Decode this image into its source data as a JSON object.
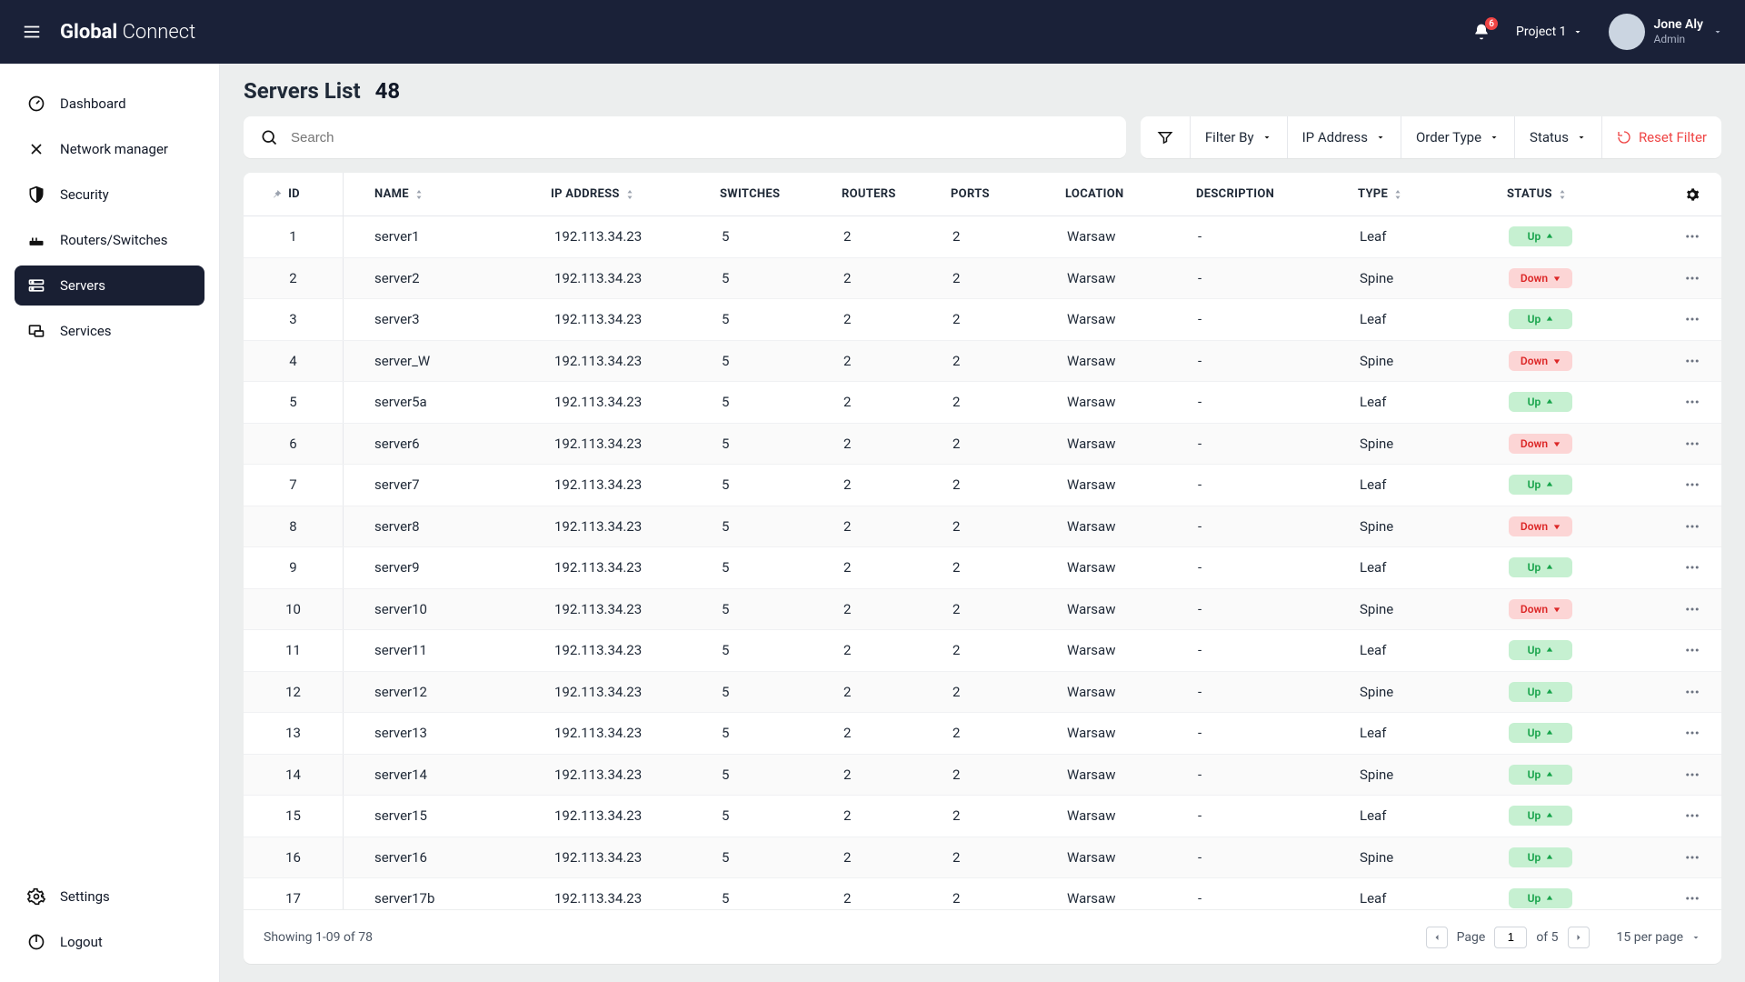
{
  "brand": {
    "bold": "Global",
    "light": "Connect"
  },
  "header": {
    "notification_count": "6",
    "project_label": "Project 1",
    "user_name": "Jone Aly",
    "user_role": "Admin"
  },
  "sidebar": {
    "items": [
      {
        "label": "Dashboard"
      },
      {
        "label": "Network manager"
      },
      {
        "label": "Security"
      },
      {
        "label": "Routers/Switches"
      },
      {
        "label": "Servers"
      },
      {
        "label": "Services"
      }
    ],
    "settings_label": "Settings",
    "logout_label": "Logout"
  },
  "page": {
    "title": "Servers List",
    "count": "48",
    "search_placeholder": "Search"
  },
  "filters": {
    "filter_by": "Filter By",
    "ip_address": "IP Address",
    "order_type": "Order Type",
    "status": "Status",
    "reset": "Reset Filter"
  },
  "columns": {
    "id": "ID",
    "name": "NAME",
    "ip": "IP ADDRESS",
    "switches": "SWITCHES",
    "routers": "ROUTERS",
    "ports": "PORTS",
    "location": "LOCATION",
    "description": "DESCRIPTION",
    "type": "TYPE",
    "status": "STATUS"
  },
  "rows": [
    {
      "id": "1",
      "name": "server1",
      "ip": "192.113.34.23",
      "switches": "5",
      "routers": "2",
      "ports": "2",
      "location": "Warsaw",
      "description": "-",
      "type": "Leaf",
      "status": "Up"
    },
    {
      "id": "2",
      "name": "server2",
      "ip": "192.113.34.23",
      "switches": "5",
      "routers": "2",
      "ports": "2",
      "location": "Warsaw",
      "description": "-",
      "type": "Spine",
      "status": "Down"
    },
    {
      "id": "3",
      "name": "server3",
      "ip": "192.113.34.23",
      "switches": "5",
      "routers": "2",
      "ports": "2",
      "location": "Warsaw",
      "description": "-",
      "type": "Leaf",
      "status": "Up"
    },
    {
      "id": "4",
      "name": "server_W",
      "ip": "192.113.34.23",
      "switches": "5",
      "routers": "2",
      "ports": "2",
      "location": "Warsaw",
      "description": "-",
      "type": "Spine",
      "status": "Down"
    },
    {
      "id": "5",
      "name": "server5a",
      "ip": "192.113.34.23",
      "switches": "5",
      "routers": "2",
      "ports": "2",
      "location": "Warsaw",
      "description": "-",
      "type": "Leaf",
      "status": "Up"
    },
    {
      "id": "6",
      "name": "server6",
      "ip": "192.113.34.23",
      "switches": "5",
      "routers": "2",
      "ports": "2",
      "location": "Warsaw",
      "description": "-",
      "type": "Spine",
      "status": "Down"
    },
    {
      "id": "7",
      "name": "server7",
      "ip": "192.113.34.23",
      "switches": "5",
      "routers": "2",
      "ports": "2",
      "location": "Warsaw",
      "description": "-",
      "type": "Leaf",
      "status": "Up"
    },
    {
      "id": "8",
      "name": "server8",
      "ip": "192.113.34.23",
      "switches": "5",
      "routers": "2",
      "ports": "2",
      "location": "Warsaw",
      "description": "-",
      "type": "Spine",
      "status": "Down"
    },
    {
      "id": "9",
      "name": "server9",
      "ip": "192.113.34.23",
      "switches": "5",
      "routers": "2",
      "ports": "2",
      "location": "Warsaw",
      "description": "-",
      "type": "Leaf",
      "status": "Up"
    },
    {
      "id": "10",
      "name": "server10",
      "ip": "192.113.34.23",
      "switches": "5",
      "routers": "2",
      "ports": "2",
      "location": "Warsaw",
      "description": "-",
      "type": "Spine",
      "status": "Down"
    },
    {
      "id": "11",
      "name": "server11",
      "ip": "192.113.34.23",
      "switches": "5",
      "routers": "2",
      "ports": "2",
      "location": "Warsaw",
      "description": "-",
      "type": "Leaf",
      "status": "Up"
    },
    {
      "id": "12",
      "name": "server12",
      "ip": "192.113.34.23",
      "switches": "5",
      "routers": "2",
      "ports": "2",
      "location": "Warsaw",
      "description": "-",
      "type": "Spine",
      "status": "Up"
    },
    {
      "id": "13",
      "name": "server13",
      "ip": "192.113.34.23",
      "switches": "5",
      "routers": "2",
      "ports": "2",
      "location": "Warsaw",
      "description": "-",
      "type": "Leaf",
      "status": "Up"
    },
    {
      "id": "14",
      "name": "server14",
      "ip": "192.113.34.23",
      "switches": "5",
      "routers": "2",
      "ports": "2",
      "location": "Warsaw",
      "description": "-",
      "type": "Spine",
      "status": "Up"
    },
    {
      "id": "15",
      "name": "server15",
      "ip": "192.113.34.23",
      "switches": "5",
      "routers": "2",
      "ports": "2",
      "location": "Warsaw",
      "description": "-",
      "type": "Leaf",
      "status": "Up"
    },
    {
      "id": "16",
      "name": "server16",
      "ip": "192.113.34.23",
      "switches": "5",
      "routers": "2",
      "ports": "2",
      "location": "Warsaw",
      "description": "-",
      "type": "Spine",
      "status": "Up"
    },
    {
      "id": "17",
      "name": "server17b",
      "ip": "192.113.34.23",
      "switches": "5",
      "routers": "2",
      "ports": "2",
      "location": "Warsaw",
      "description": "-",
      "type": "Leaf",
      "status": "Up"
    }
  ],
  "footer": {
    "showing": "Showing 1-09 of 78",
    "page_label": "Page",
    "page_value": "1",
    "of_label": "of 5",
    "perpage_label": "15 per page"
  }
}
